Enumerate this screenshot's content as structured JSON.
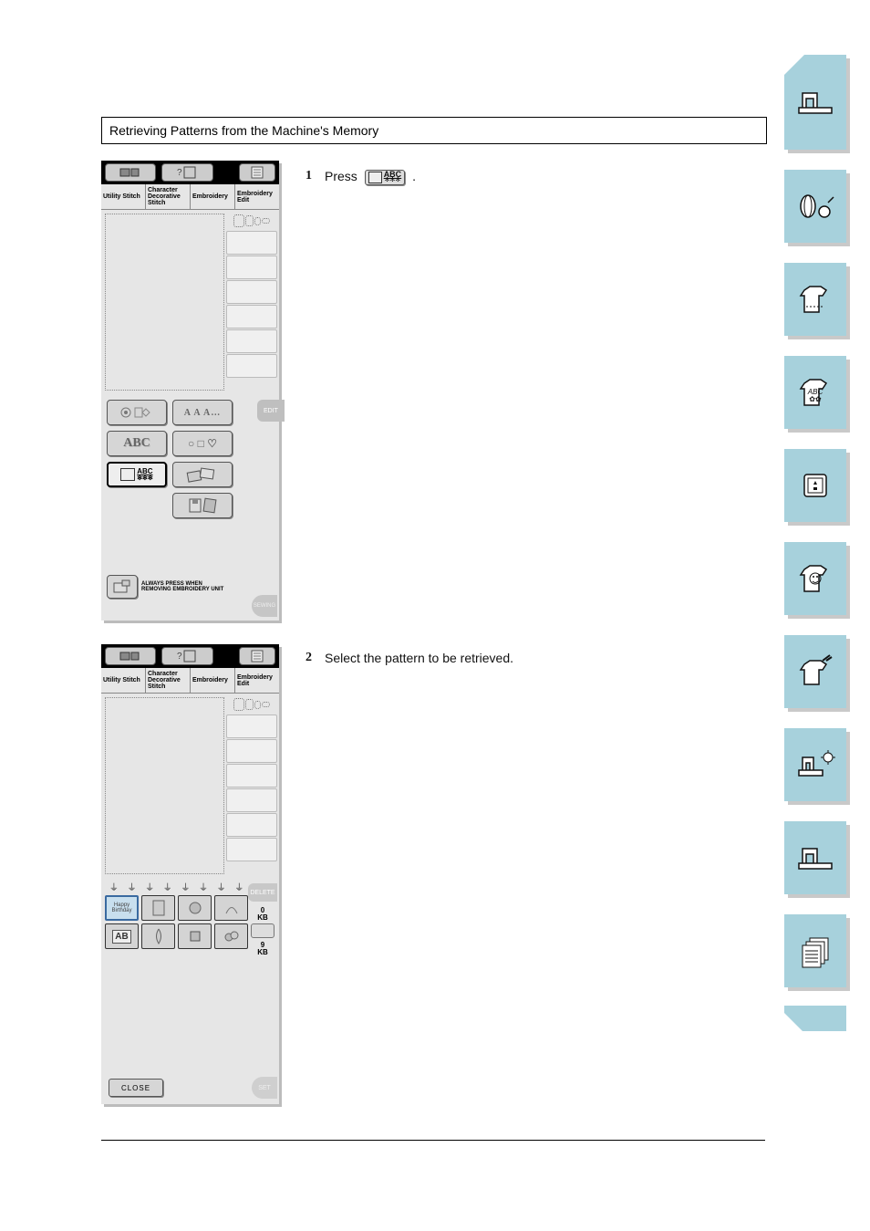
{
  "instruction": "Retrieving Patterns from the Machine's Memory",
  "steps": {
    "s1_num": "1",
    "s1_text": "Press",
    "s1_after": ".",
    "s2_num": "2",
    "s2_text": "Select the pattern to be retrieved."
  },
  "callout": {
    "label_top": "ABC",
    "label_bot": "✻✻✻"
  },
  "screen1": {
    "tabs": [
      "Utility Stitch",
      "Character Decorative Stitch",
      "Embroidery",
      "Embroidery Edit"
    ],
    "buttons": {
      "b1": "",
      "b2": "A A A…",
      "b3": "ABC",
      "b4": "○ □ ♡",
      "b5_top": "ABC",
      "b5_bot": "✻✻✻",
      "b6": "",
      "b7": ""
    },
    "edit": "EDIT",
    "remove_text": "ALWAYS PRESS WHEN REMOVING EMBROIDERY UNIT",
    "sewing": "SEWING"
  },
  "screen2": {
    "tabs": [
      "Utility Stitch",
      "Character Decorative Stitch",
      "Embroidery",
      "Embroidery Edit"
    ],
    "thumbs": [
      "Happy Birthday",
      "",
      "",
      "",
      "AB",
      "",
      "",
      ""
    ],
    "delete": "DELETE",
    "kb1_num": "0",
    "kb1_unit": "KB",
    "kb2_num": "9",
    "kb2_unit": "KB",
    "close": "CLOSE",
    "set": "SET"
  },
  "side_icons": [
    "machine",
    "thread",
    "shirt",
    "shirt-abc",
    "disk",
    "shirt-help",
    "shirt-tools",
    "maintenance",
    "machine2",
    "pages"
  ]
}
